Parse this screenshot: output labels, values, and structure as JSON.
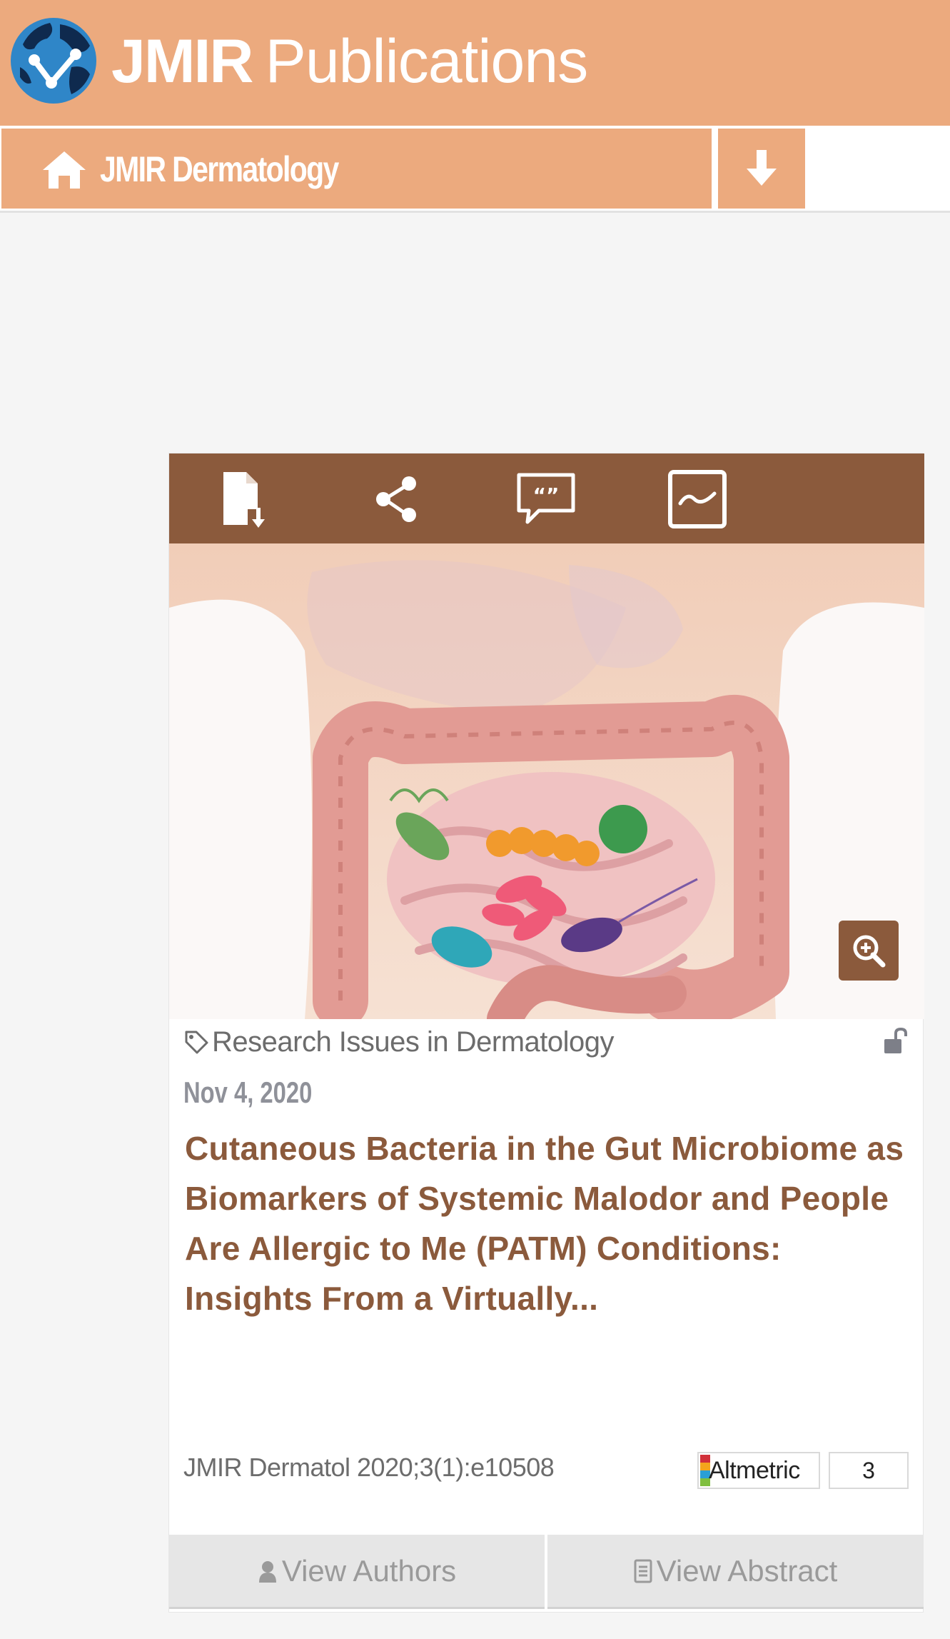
{
  "header": {
    "brand_bold": "JMIR",
    "brand_light": "Publications",
    "logo_icon": "jmir-globe-logo",
    "colors": {
      "header_bg": "#ecaa7e",
      "toolbar_bg": "#8b5a3c",
      "title": "#8b5a3c"
    }
  },
  "nav": {
    "journal_name": "JMIR Dermatology",
    "home_icon": "home-icon",
    "download_icon": "arrow-down-icon"
  },
  "card": {
    "toolbar_icons": [
      "pdf-download-icon",
      "share-icon",
      "cite-quote-icon",
      "metrics-chart-icon"
    ],
    "image_alt": "gut microbiome illustration",
    "zoom_icon": "zoom-in-icon",
    "section": "Research Issues in Dermatology",
    "open_access_icon": "unlocked-icon",
    "date": "Nov 4, 2020",
    "title": "Cutaneous Bacteria in the Gut Microbiome as Biomarkers of Systemic Malodor and People Are Allergic to Me (PATM) Conditions: Insights From a Virtually...",
    "citation": "JMIR Dermatol 2020;3(1):e10508",
    "altmetric_label": "Altmetric",
    "altmetric_score": "3",
    "view_authors": "View Authors",
    "view_abstract": "View Abstract"
  }
}
